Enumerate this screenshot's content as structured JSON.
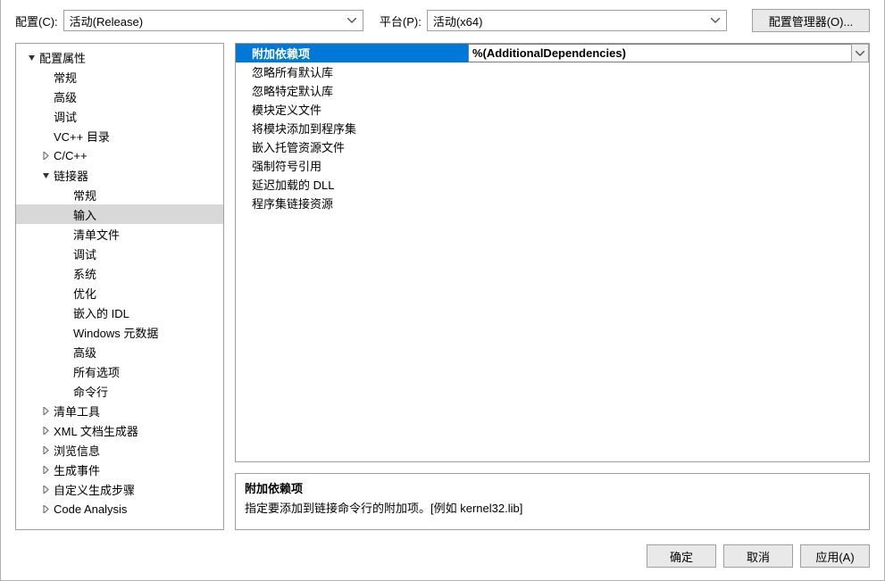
{
  "top": {
    "config_label": "配置(C):",
    "config_value": "活动(Release)",
    "platform_label": "平台(P):",
    "platform_value": "活动(x64)",
    "config_manager_btn": "配置管理器(O)..."
  },
  "tree": [
    {
      "label": "配置属性",
      "indent": 0,
      "arrow": "down"
    },
    {
      "label": "常规",
      "indent": 1,
      "arrow": ""
    },
    {
      "label": "高级",
      "indent": 1,
      "arrow": ""
    },
    {
      "label": "调试",
      "indent": 1,
      "arrow": ""
    },
    {
      "label": "VC++ 目录",
      "indent": 1,
      "arrow": ""
    },
    {
      "label": "C/C++",
      "indent": 1,
      "arrow": "right"
    },
    {
      "label": "链接器",
      "indent": 1,
      "arrow": "down"
    },
    {
      "label": "常规",
      "indent": 2,
      "arrow": ""
    },
    {
      "label": "输入",
      "indent": 2,
      "arrow": "",
      "selected": true
    },
    {
      "label": "清单文件",
      "indent": 2,
      "arrow": ""
    },
    {
      "label": "调试",
      "indent": 2,
      "arrow": ""
    },
    {
      "label": "系统",
      "indent": 2,
      "arrow": ""
    },
    {
      "label": "优化",
      "indent": 2,
      "arrow": ""
    },
    {
      "label": "嵌入的 IDL",
      "indent": 2,
      "arrow": ""
    },
    {
      "label": "Windows 元数据",
      "indent": 2,
      "arrow": ""
    },
    {
      "label": "高级",
      "indent": 2,
      "arrow": ""
    },
    {
      "label": "所有选项",
      "indent": 2,
      "arrow": ""
    },
    {
      "label": "命令行",
      "indent": 2,
      "arrow": ""
    },
    {
      "label": "清单工具",
      "indent": 1,
      "arrow": "right"
    },
    {
      "label": "XML 文档生成器",
      "indent": 1,
      "arrow": "right"
    },
    {
      "label": "浏览信息",
      "indent": 1,
      "arrow": "right"
    },
    {
      "label": "生成事件",
      "indent": 1,
      "arrow": "right"
    },
    {
      "label": "自定义生成步骤",
      "indent": 1,
      "arrow": "right"
    },
    {
      "label": "Code Analysis",
      "indent": 1,
      "arrow": "right"
    }
  ],
  "grid": [
    {
      "label": "附加依赖项",
      "value": "%(AdditionalDependencies)",
      "selected": true
    },
    {
      "label": "忽略所有默认库",
      "value": ""
    },
    {
      "label": "忽略特定默认库",
      "value": ""
    },
    {
      "label": "模块定义文件",
      "value": ""
    },
    {
      "label": "将模块添加到程序集",
      "value": ""
    },
    {
      "label": "嵌入托管资源文件",
      "value": ""
    },
    {
      "label": "强制符号引用",
      "value": ""
    },
    {
      "label": "延迟加载的 DLL",
      "value": ""
    },
    {
      "label": "程序集链接资源",
      "value": ""
    }
  ],
  "desc": {
    "title": "附加依赖项",
    "body": "指定要添加到链接命令行的附加项。[例如 kernel32.lib]"
  },
  "buttons": {
    "ok": "确定",
    "cancel": "取消",
    "apply": "应用(A)"
  }
}
